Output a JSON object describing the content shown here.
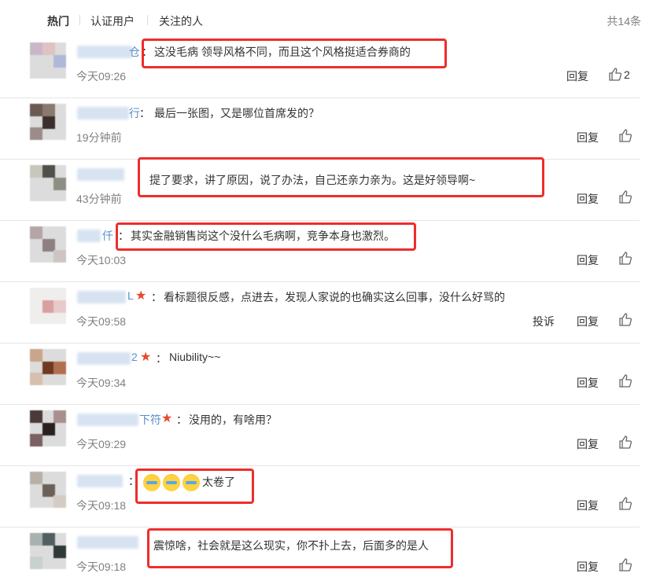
{
  "tabs": {
    "hot": "热门",
    "verified": "认证用户",
    "following": "关注的人",
    "total": "共14条"
  },
  "actions": {
    "reply": "回复",
    "report": "投诉"
  },
  "comments": [
    {
      "name_tail": "仓",
      "text": "这没毛病 领导风格不同，而且这个风格挺适合券商的",
      "time": "今天09:26",
      "likes": "2"
    },
    {
      "name_tail": "行",
      "text": "最后一张图，又是哪位首席发的？",
      "time": "19分钟前"
    },
    {
      "name_tail": "",
      "text": "提了要求，讲了原因，说了办法，自己还亲力亲为。这是好领导啊~",
      "time": "43分钟前"
    },
    {
      "name_tail": "仟",
      "text": "其实金融销售岗这个没什么毛病啊，竞争本身也激烈。",
      "time": "今天10:03"
    },
    {
      "name_tail": "L",
      "text": "看标题很反感，点进去，发现人家说的也确实这么回事，没什么好骂的",
      "time": "今天09:58"
    },
    {
      "name_tail": "2",
      "text": "Niubility~~",
      "time": "今天09:34"
    },
    {
      "name_tail": "下符",
      "text": "没用的，有啥用？",
      "time": "今天09:29"
    },
    {
      "name_tail": "",
      "text": "太卷了",
      "time": "今天09:18",
      "emoji": [
        "laugh-cry",
        "laugh-cry",
        "laugh-cry"
      ]
    },
    {
      "name_tail": "",
      "text": "震惊啥，社会就是这么现实，你不扑上去，后面多的是人",
      "time": "今天09:18"
    }
  ],
  "colors": {
    "highlight": "#ee2d2d",
    "username": "#5a8ec8",
    "badge": "#e8482f"
  }
}
